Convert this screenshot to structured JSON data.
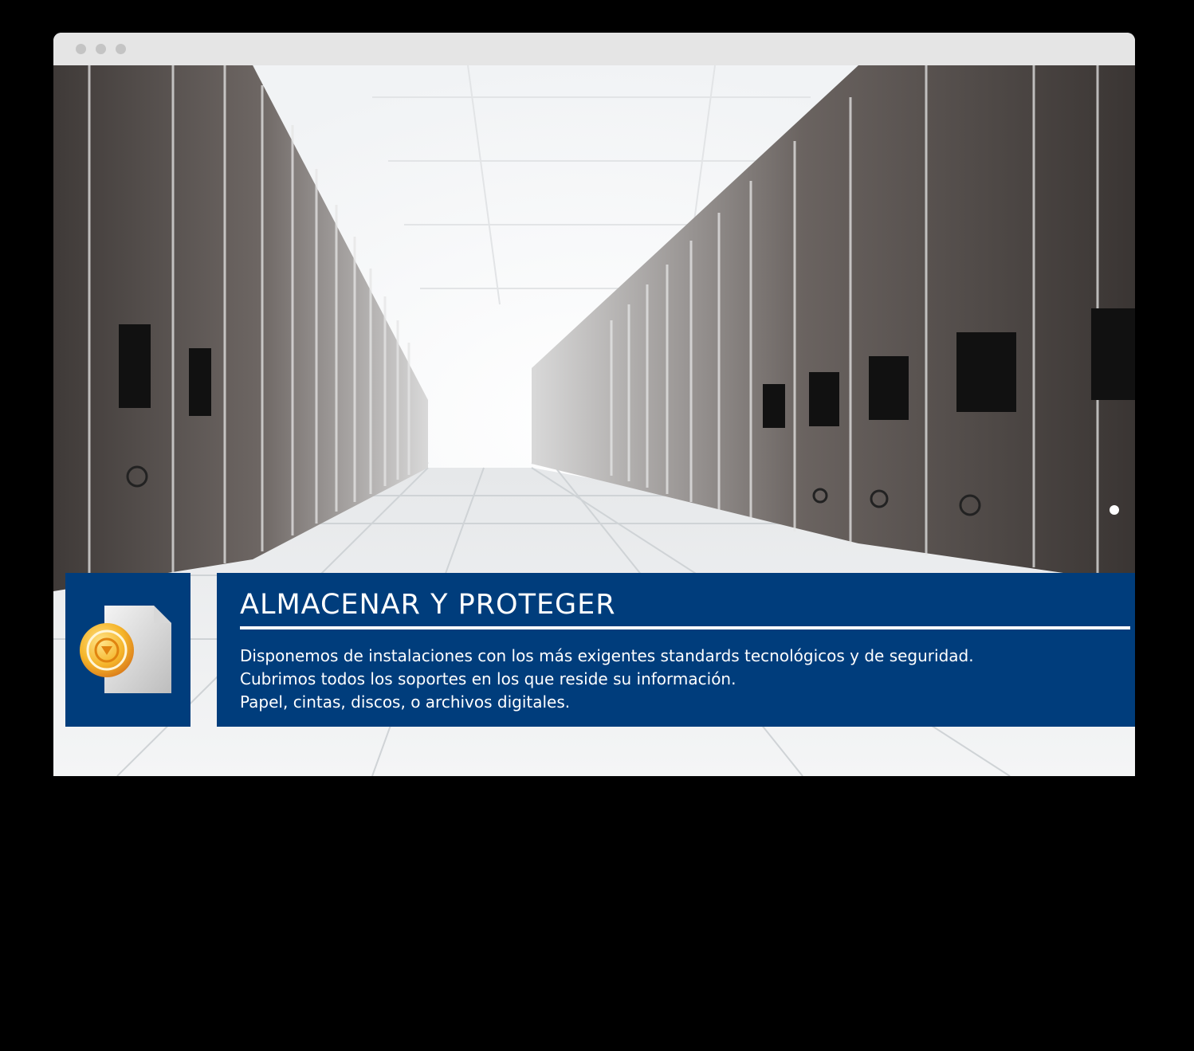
{
  "window": {
    "controls": [
      "close",
      "minimize",
      "maximize"
    ]
  },
  "hero": {
    "image": "server-room-corridor"
  },
  "feature": {
    "icon": "document-safe-icon",
    "title": "ALMACENAR Y PROTEGER",
    "lines": [
      "Disponemos de instalaciones con los más exigentes standards tecnológicos y de seguridad.",
      "Cubrimos todos los soportes en los que reside su información.",
      "Papel, cintas, discos, o archivos digitales."
    ]
  },
  "colors": {
    "panel": "#003d7c",
    "titlebar": "#e5e5e5",
    "accent": "#f5a623"
  }
}
